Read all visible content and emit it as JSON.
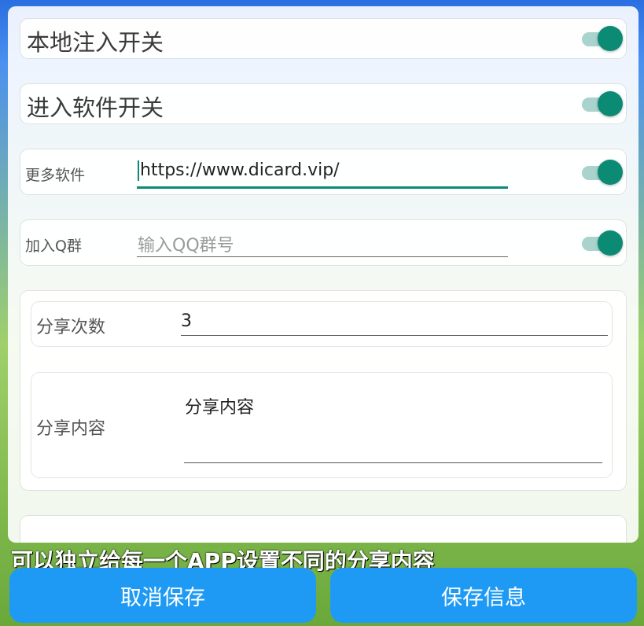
{
  "background": {
    "banner_text": "可以独立给每一个APP设置不同的分享内容"
  },
  "settings": {
    "local_inject": {
      "label": "本地注入开关",
      "enabled": true
    },
    "enter_software": {
      "label": "进入软件开关",
      "enabled": true
    },
    "more_software": {
      "label": "更多软件",
      "value": "https://www.dicard.vip/",
      "enabled": true
    },
    "join_qq_group": {
      "label": "加入Q群",
      "placeholder": "输入QQ群号",
      "value": "",
      "enabled": true
    }
  },
  "share": {
    "count_label": "分享次数",
    "count_value": "3",
    "content_label": "分享内容",
    "content_value": "分享内容"
  },
  "buttons": {
    "cancel": "取消保存",
    "save": "保存信息"
  },
  "colors": {
    "accent": "#0b8a74",
    "toggle_track": "#a9d3cc",
    "button": "#1e9af5"
  }
}
